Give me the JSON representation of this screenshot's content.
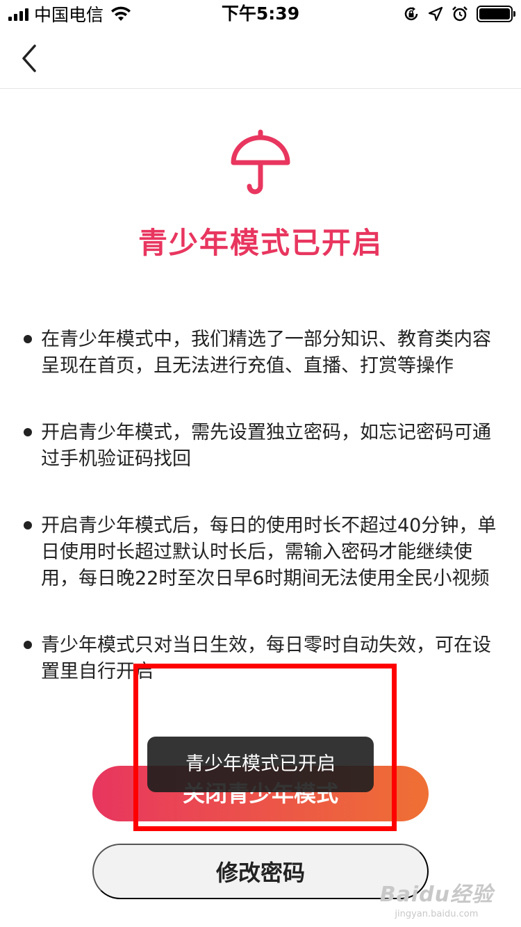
{
  "status_bar": {
    "carrier": "中国电信",
    "time": "下午5:39"
  },
  "icons": {
    "back": "chevron-left-icon",
    "main": "umbrella-icon"
  },
  "colors": {
    "accent": "#e8365f",
    "gradient_end": "#ef7034",
    "highlight_box": "#ff0000"
  },
  "main": {
    "title": "青少年模式已开启",
    "bullets": [
      "在青少年模式中，我们精选了一部分知识、教育类内容呈现在首页，且无法进行充值、直播、打赏等操作",
      "开启青少年模式，需先设置独立密码，如忘记密码可通过手机验证码找回",
      "开启青少年模式后，每日的使用时长不超过40分钟，单日使用时长超过默认时长后，需输入密码才能继续使用，每日晚22时至次日早6时期间无法使用全民小视频",
      "青少年模式只对当日生效，每日零时自动失效，可在设置里自行开启"
    ]
  },
  "buttons": {
    "close_label": "关闭青少年模式",
    "change_password_label": "修改密码"
  },
  "toast": {
    "message": "青少年模式已开启"
  },
  "watermark": {
    "logo": "Baidu经验",
    "url": "jingyan.baidu.com"
  }
}
